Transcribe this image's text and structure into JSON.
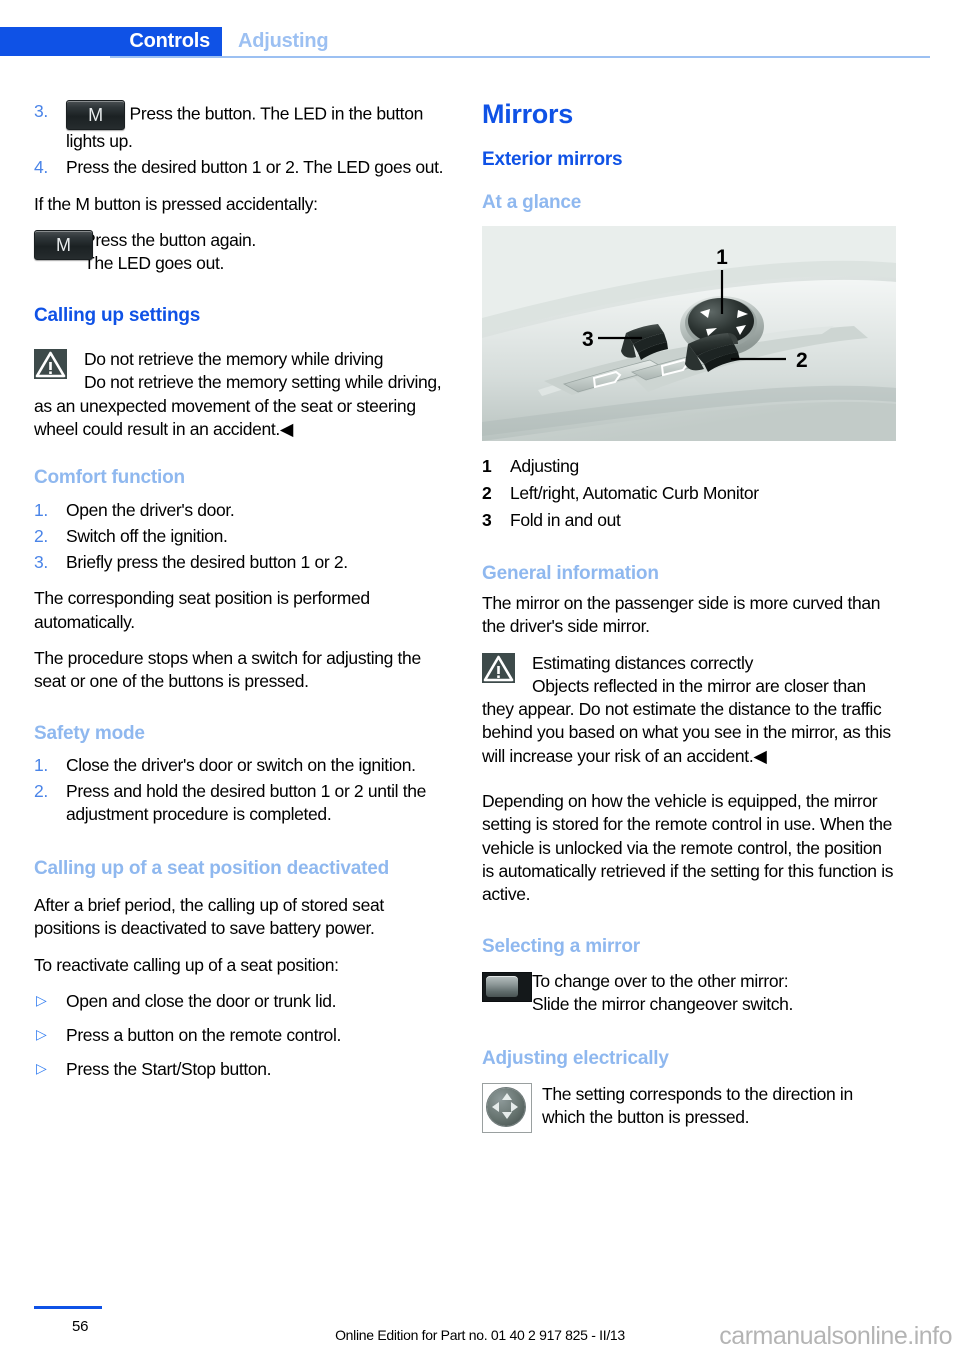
{
  "header": {
    "active_tab": "Controls",
    "inactive_tab": "Adjusting",
    "accent_color": "#0f52e6",
    "muted_color": "#9cc0f2"
  },
  "left_column": {
    "step3": {
      "marker": "3.",
      "icon": "m-button-icon",
      "text": "Press the button. The LED in the button lights up."
    },
    "step4": {
      "marker": "4.",
      "text": "Press the desired button 1 or 2. The LED goes out."
    },
    "accidental_intro": "If the M button is pressed accidentally:",
    "accidental_line1": "Press the button again.",
    "accidental_line2": "The LED goes out.",
    "calling_up_settings": {
      "heading": "Calling up settings",
      "warning_title": "Do not retrieve the memory while driving",
      "warning_body": "Do not retrieve the memory setting while driving, as an unexpected movement of the seat or steering wheel could result in an accident.◀"
    },
    "comfort_function": {
      "heading": "Comfort function",
      "steps": [
        {
          "marker": "1.",
          "text": "Open the driver's door."
        },
        {
          "marker": "2.",
          "text": "Switch off the ignition."
        },
        {
          "marker": "3.",
          "text": "Briefly press the desired button 1 or 2."
        }
      ],
      "para1": "The corresponding seat position is performed automatically.",
      "para2": "The procedure stops when a switch for adjusting the seat or one of the buttons is pressed."
    },
    "safety_mode": {
      "heading": "Safety mode",
      "steps": [
        {
          "marker": "1.",
          "text": "Close the driver's door or switch on the ignition."
        },
        {
          "marker": "2.",
          "text": "Press and hold the desired button 1 or 2 until the adjustment procedure is completed."
        }
      ]
    },
    "seat_position_deactivated": {
      "heading": "Calling up of a seat position deactivated",
      "para1": "After a brief period, the calling up of stored seat positions is deactivated to save battery power.",
      "para2": "To reactivate calling up of a seat position:",
      "bullets": [
        {
          "marker": "▷",
          "text": "Open and close the door or trunk lid."
        },
        {
          "marker": "▷",
          "text": "Press a button on the remote control."
        },
        {
          "marker": "▷",
          "text": "Press the Start/Stop button."
        }
      ]
    }
  },
  "right_column": {
    "title": "Mirrors",
    "subtitle": "Exterior mirrors",
    "at_a_glance": {
      "heading": "At a glance",
      "figure_alt": "door-control-panel-illustration",
      "callouts": [
        "1",
        "2",
        "3"
      ],
      "legend": [
        {
          "marker": "1",
          "text": "Adjusting"
        },
        {
          "marker": "2",
          "text": "Left/right, Automatic Curb Monitor"
        },
        {
          "marker": "3",
          "text": "Fold in and out"
        }
      ]
    },
    "general_information": {
      "heading": "General information",
      "para1": "The mirror on the passenger side is more curved than the driver's side mirror.",
      "warning_title": "Estimating distances correctly",
      "warning_body": "Objects reflected in the mirror are closer than they appear. Do not estimate the distance to the traffic behind you based on what you see in the mirror, as this will increase your risk of an accident.◀",
      "para2": "Depending on how the vehicle is equipped, the mirror setting is stored for the remote control in use. When the vehicle is unlocked via the remote control, the position is automatically retrieved if the setting for this function is active."
    },
    "selecting_a_mirror": {
      "heading": "Selecting a mirror",
      "line1": "To change over to the other mirror:",
      "line2": "Slide the mirror changeover switch."
    },
    "adjusting_electrically": {
      "heading": "Adjusting electrically",
      "text": "The setting corresponds to the direction in which the button is pressed."
    }
  },
  "footer": {
    "page_number": "56",
    "edition": "Online Edition for Part no. 01 40 2 917 825 - II/13",
    "watermark": "carmanualsonline.info"
  }
}
